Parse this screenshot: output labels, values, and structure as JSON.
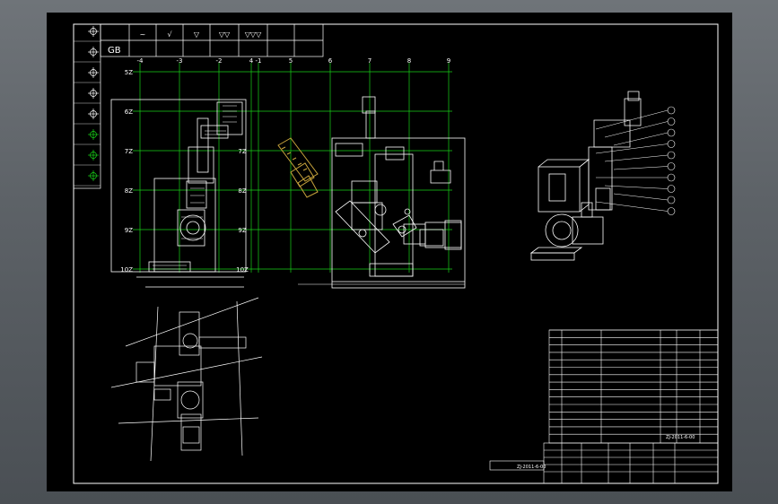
{
  "colors": {
    "background": "#000000",
    "frame": "#ffffff",
    "grid": "#19d219",
    "highlight": "#c8a43c"
  },
  "standard_label": "GB",
  "surface_symbols": [
    "~",
    "√",
    "▽",
    "▽▽",
    "▽▽▽"
  ],
  "grid_top_labels": [
    "-4",
    "-3",
    "-2",
    "-1",
    "4",
    "5",
    "6",
    "7",
    "8",
    "9"
  ],
  "grid_side_labels": [
    "5Z",
    "6Z",
    "7Z",
    "8Z",
    "9Z",
    "10Z"
  ],
  "grid_mid_labels": [
    "7Z",
    "8Z",
    "9Z",
    "10Z"
  ],
  "drawing_number": "ZJ-2011-6-00",
  "sheet_note": "ZJ-2011-6-00"
}
